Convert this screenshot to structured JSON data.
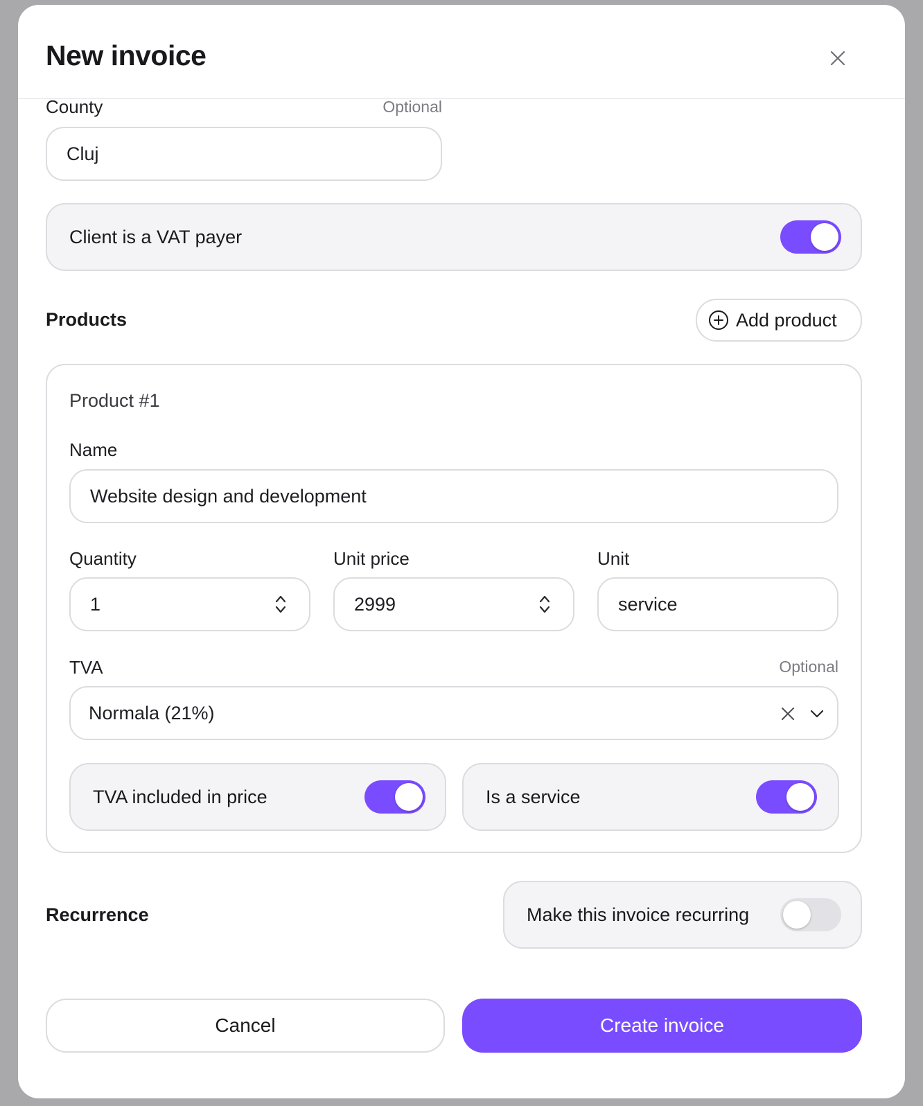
{
  "modal": {
    "title": "New invoice"
  },
  "county": {
    "label": "County",
    "optional": "Optional",
    "value": "Cluj"
  },
  "vat_payer": {
    "label": "Client is a VAT payer",
    "enabled": true
  },
  "products": {
    "title": "Products",
    "add_button": "Add product",
    "items": [
      {
        "heading": "Product #1",
        "name_label": "Name",
        "name_value": "Website design and development",
        "quantity_label": "Quantity",
        "quantity_value": "1",
        "unit_price_label": "Unit price",
        "unit_price_value": "2999",
        "unit_label": "Unit",
        "unit_value": "service",
        "tva_label": "TVA",
        "tva_optional": "Optional",
        "tva_value": "Normala (21%)",
        "tva_included_label": "TVA included in price",
        "tva_included": true,
        "is_service_label": "Is a service",
        "is_service": true
      }
    ]
  },
  "recurrence": {
    "title": "Recurrence",
    "toggle_label": "Make this invoice recurring",
    "enabled": false
  },
  "footer": {
    "cancel": "Cancel",
    "create": "Create invoice"
  },
  "colors": {
    "accent": "#7a4cff",
    "backdrop": "#a9a9ab"
  }
}
